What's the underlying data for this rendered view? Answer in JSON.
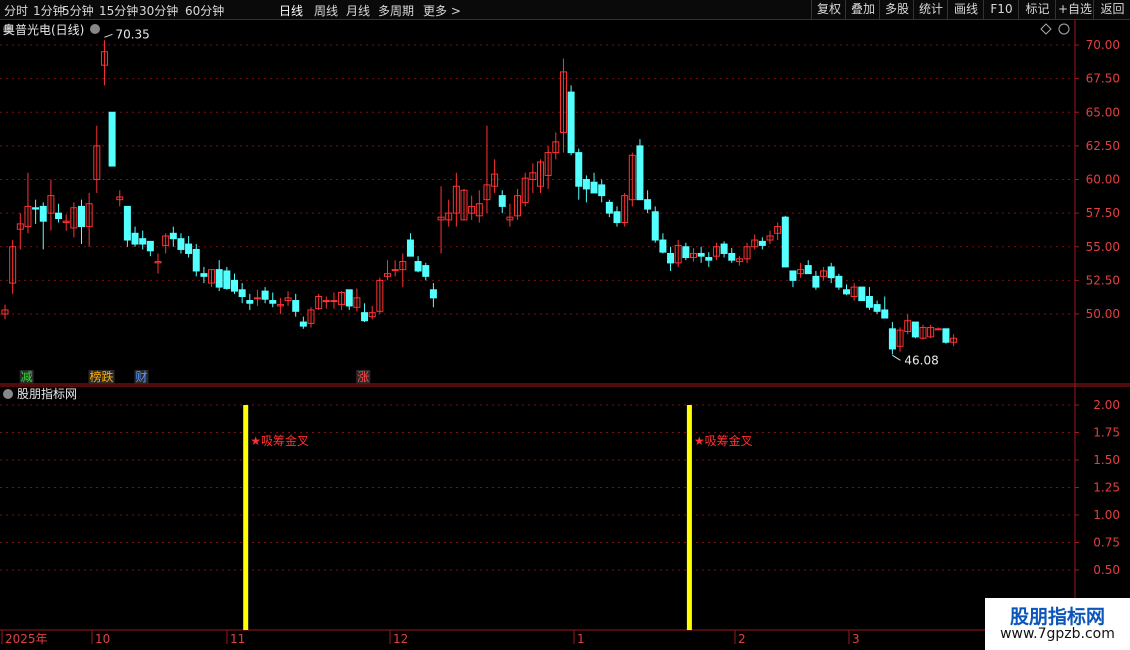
{
  "toolbar": {
    "periods": [
      "分时",
      "1分钟",
      "5分钟",
      "15分钟",
      "30分钟",
      "60分钟",
      "日线",
      "周线",
      "月线",
      "多周期",
      "更多 >"
    ],
    "active_period": "日线",
    "right_buttons": [
      "复权",
      "叠加",
      "多股",
      "统计",
      "画线",
      "F10",
      "标记",
      "+自选",
      "返回"
    ]
  },
  "main_panel": {
    "title": "奥普光电(日线)"
  },
  "indicator_panel": {
    "title": "股朋指标网"
  },
  "watermark": {
    "line1": "股朋指标网",
    "line2": "www.7gpzb.com"
  },
  "colors": {
    "up": "#ff3232",
    "down": "#54ffff",
    "grid": "#7a1010",
    "signal_bar": "#ffff00",
    "signal_text": "#ff3030"
  },
  "chart_data": [
    {
      "type": "candlestick",
      "title": "奥普光电(日线)",
      "y_ticks": [
        "70.00",
        "67.50",
        "65.00",
        "62.50",
        "60.00",
        "57.50",
        "55.00",
        "52.50",
        "50.00"
      ],
      "ylim": [
        46.0,
        71.0
      ],
      "high_marker": "70.35",
      "low_marker": "46.08",
      "x_axis_labels": [
        "2025年",
        "10",
        "11",
        "12",
        "1",
        "2",
        "3"
      ],
      "event_tags": [
        {
          "text": "减",
          "color": "#33dd33",
          "index": 1
        },
        {
          "text": "榜跌",
          "color": "#ffaa00",
          "index": 10
        },
        {
          "text": "财",
          "color": "#5599ff",
          "index": 16
        },
        {
          "text": "涨",
          "color": "#ff4444",
          "index": 45
        }
      ],
      "ohlc": [
        [
          50.0,
          50.7,
          49.6,
          50.3
        ],
        [
          52.3,
          55.5,
          51.5,
          55.0
        ],
        [
          56.3,
          57.5,
          54.8,
          56.7
        ],
        [
          56.5,
          60.5,
          56.0,
          58.0
        ],
        [
          57.9,
          58.5,
          56.7,
          57.8
        ],
        [
          58.0,
          58.3,
          54.8,
          56.9
        ],
        [
          57.5,
          60.0,
          56.2,
          58.8
        ],
        [
          57.5,
          58.2,
          56.8,
          57.1
        ],
        [
          56.8,
          57.4,
          56.2,
          56.9
        ],
        [
          56.4,
          58.3,
          55.7,
          57.9
        ],
        [
          58.0,
          58.5,
          55.2,
          56.5
        ],
        [
          56.5,
          59.0,
          55.0,
          58.2
        ],
        [
          60.0,
          64.0,
          59.0,
          62.5
        ],
        [
          68.5,
          70.35,
          67.0,
          69.5
        ],
        [
          65.0,
          65.0,
          61.0,
          61.0
        ],
        [
          58.5,
          59.2,
          58.0,
          58.7
        ],
        [
          58.0,
          58.0,
          55.0,
          55.5
        ],
        [
          56.0,
          56.5,
          55.0,
          55.2
        ],
        [
          55.6,
          56.2,
          54.8,
          55.2
        ],
        [
          55.4,
          55.4,
          54.3,
          54.7
        ],
        [
          53.8,
          54.5,
          53.0,
          53.9
        ],
        [
          55.1,
          56.0,
          54.5,
          55.8
        ],
        [
          56.0,
          56.5,
          55.0,
          55.6
        ],
        [
          55.6,
          56.0,
          54.5,
          54.8
        ],
        [
          55.2,
          55.8,
          54.2,
          54.5
        ],
        [
          54.8,
          55.2,
          52.8,
          53.2
        ],
        [
          53.0,
          53.5,
          52.3,
          52.8
        ],
        [
          52.3,
          53.3,
          52.0,
          53.3
        ],
        [
          53.3,
          54.0,
          51.7,
          52.0
        ],
        [
          53.2,
          53.5,
          51.8,
          51.9
        ],
        [
          52.5,
          53.0,
          51.5,
          51.7
        ],
        [
          51.8,
          52.3,
          50.8,
          51.3
        ],
        [
          51.0,
          51.5,
          50.3,
          50.8
        ],
        [
          51.2,
          51.8,
          50.6,
          51.2
        ],
        [
          51.7,
          52.0,
          50.8,
          51.1
        ],
        [
          51.0,
          51.6,
          50.5,
          50.8
        ],
        [
          50.6,
          51.2,
          50.0,
          50.7
        ],
        [
          51.0,
          51.7,
          50.6,
          51.2
        ],
        [
          51.0,
          51.5,
          49.8,
          50.2
        ],
        [
          49.4,
          49.8,
          48.9,
          49.1
        ],
        [
          49.3,
          50.5,
          49.0,
          50.3
        ],
        [
          50.4,
          51.5,
          50.3,
          51.3
        ],
        [
          51.0,
          51.3,
          50.4,
          51.0
        ],
        [
          51.0,
          51.6,
          50.4,
          51.0
        ],
        [
          50.7,
          51.7,
          50.3,
          51.6
        ],
        [
          51.8,
          51.8,
          50.3,
          50.6
        ],
        [
          50.5,
          51.9,
          50.2,
          51.2
        ],
        [
          50.1,
          50.8,
          49.4,
          49.5
        ],
        [
          49.8,
          50.6,
          49.6,
          50.1
        ],
        [
          50.2,
          52.7,
          50.0,
          52.5
        ],
        [
          52.8,
          54.0,
          52.5,
          53.0
        ],
        [
          53.3,
          54.0,
          52.8,
          53.3
        ],
        [
          53.3,
          54.5,
          52.0,
          53.9
        ],
        [
          55.5,
          56.0,
          54.3,
          54.3
        ],
        [
          53.9,
          54.3,
          53.1,
          53.2
        ],
        [
          53.6,
          53.8,
          52.5,
          52.8
        ],
        [
          51.8,
          52.3,
          50.5,
          51.2
        ],
        [
          57.0,
          59.5,
          54.5,
          57.2
        ],
        [
          57.0,
          58.5,
          56.5,
          57.5
        ],
        [
          57.5,
          60.5,
          56.5,
          59.5
        ],
        [
          57.0,
          59.3,
          57.0,
          59.2
        ],
        [
          57.5,
          58.8,
          57.0,
          58.0
        ],
        [
          57.3,
          59.2,
          56.8,
          58.2
        ],
        [
          58.5,
          64.0,
          57.5,
          59.6
        ],
        [
          59.5,
          61.5,
          59.0,
          60.4
        ],
        [
          58.8,
          59.2,
          57.5,
          58.0
        ],
        [
          57.0,
          58.2,
          56.5,
          57.2
        ],
        [
          57.3,
          59.3,
          57.0,
          58.8
        ],
        [
          58.3,
          60.5,
          58.0,
          60.1
        ],
        [
          60.0,
          61.2,
          59.0,
          60.5
        ],
        [
          59.5,
          61.5,
          59.0,
          61.3
        ],
        [
          60.3,
          62.5,
          59.3,
          62.0
        ],
        [
          62.0,
          63.5,
          61.5,
          62.8
        ],
        [
          63.5,
          69.0,
          62.0,
          68.0
        ],
        [
          66.5,
          67.0,
          61.8,
          62.0
        ],
        [
          62.0,
          62.3,
          58.5,
          59.5
        ],
        [
          60.0,
          60.3,
          58.3,
          59.3
        ],
        [
          59.8,
          60.5,
          59.0,
          59.0
        ],
        [
          59.6,
          60.0,
          58.3,
          58.8
        ],
        [
          58.3,
          58.5,
          57.2,
          57.5
        ],
        [
          57.6,
          58.0,
          56.5,
          56.8
        ],
        [
          56.8,
          59.0,
          56.5,
          58.8
        ],
        [
          58.5,
          62.0,
          58.0,
          61.8
        ],
        [
          62.5,
          63.0,
          58.5,
          58.5
        ],
        [
          58.5,
          59.2,
          57.5,
          57.8
        ],
        [
          57.6,
          58.0,
          55.3,
          55.5
        ],
        [
          55.5,
          56.0,
          54.5,
          54.6
        ],
        [
          54.5,
          55.0,
          53.2,
          53.8
        ],
        [
          53.8,
          55.5,
          53.5,
          55.1
        ],
        [
          55.0,
          55.3,
          54.0,
          54.2
        ],
        [
          54.2,
          54.9,
          53.9,
          54.5
        ],
        [
          54.5,
          55.0,
          53.8,
          54.3
        ],
        [
          54.2,
          54.6,
          53.5,
          54.0
        ],
        [
          54.3,
          55.3,
          54.0,
          55.0
        ],
        [
          55.2,
          55.4,
          54.2,
          54.5
        ],
        [
          54.5,
          54.9,
          53.8,
          54.0
        ],
        [
          53.9,
          54.3,
          53.6,
          54.1
        ],
        [
          54.1,
          55.3,
          53.8,
          55.0
        ],
        [
          55.0,
          55.9,
          54.8,
          55.5
        ],
        [
          55.4,
          55.7,
          54.8,
          55.1
        ],
        [
          55.5,
          56.2,
          55.2,
          55.8
        ],
        [
          56.0,
          56.8,
          55.5,
          56.5
        ],
        [
          57.2,
          57.3,
          53.5,
          53.5
        ],
        [
          53.2,
          53.2,
          52.0,
          52.5
        ],
        [
          53.0,
          53.8,
          52.7,
          53.3
        ],
        [
          53.6,
          54.0,
          53.0,
          53.0
        ],
        [
          52.8,
          53.2,
          51.8,
          52.0
        ],
        [
          52.8,
          53.5,
          52.5,
          53.2
        ],
        [
          53.5,
          53.8,
          52.3,
          52.7
        ],
        [
          52.8,
          53.0,
          51.8,
          52.0
        ],
        [
          51.8,
          52.2,
          51.4,
          51.5
        ],
        [
          51.3,
          52.3,
          51.0,
          52.0
        ],
        [
          52.0,
          52.0,
          51.0,
          51.0
        ],
        [
          51.3,
          52.0,
          50.3,
          50.5
        ],
        [
          50.7,
          51.0,
          50.0,
          50.2
        ],
        [
          50.3,
          51.3,
          49.7,
          49.7
        ],
        [
          48.9,
          49.4,
          47.0,
          47.4
        ],
        [
          47.6,
          49.0,
          47.2,
          48.8
        ],
        [
          48.7,
          50.0,
          48.5,
          49.5
        ],
        [
          49.4,
          49.4,
          48.2,
          48.3
        ],
        [
          48.2,
          49.2,
          48.1,
          49.0
        ],
        [
          48.3,
          49.2,
          48.2,
          49.0
        ],
        [
          48.9,
          49.0,
          48.8,
          48.9
        ],
        [
          48.9,
          48.9,
          47.8,
          47.9
        ],
        [
          47.9,
          48.5,
          47.6,
          48.2
        ]
      ]
    },
    {
      "type": "bar",
      "title": "股朋指标网",
      "y_ticks": [
        "2.00",
        "1.75",
        "1.50",
        "1.25",
        "1.00",
        "0.75",
        "0.50"
      ],
      "ylim": [
        0,
        2.1
      ],
      "signals": [
        {
          "index": 28,
          "value": 2.0,
          "label": "吸筹金叉"
        },
        {
          "index": 86,
          "value": 2.0,
          "label": "吸筹金叉"
        }
      ]
    }
  ]
}
